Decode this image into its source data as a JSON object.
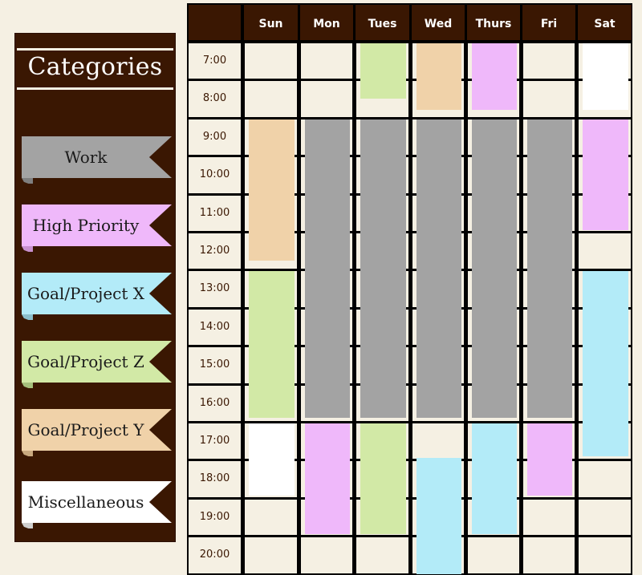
{
  "sidebar": {
    "title": "Categories",
    "categories": [
      {
        "key": "work",
        "label": "Work",
        "color": "#a3a3a3",
        "fold": "#7f7f7f"
      },
      {
        "key": "high",
        "label": "High Priority",
        "color": "#efb8fa",
        "fold": "#c890cf"
      },
      {
        "key": "goalx",
        "label": "Goal/Project X",
        "color": "#b3ebf8",
        "fold": "#8bbfcc"
      },
      {
        "key": "goalz",
        "label": "Goal/Project Z",
        "color": "#d2e9a6",
        "fold": "#a6c07c"
      },
      {
        "key": "goaly",
        "label": "Goal/Project Y",
        "color": "#f0d2a9",
        "fold": "#c9a97f"
      },
      {
        "key": "misc",
        "label": "Miscellaneous",
        "color": "#ffffff",
        "fold": "#cfcfcf"
      }
    ]
  },
  "calendar": {
    "days": [
      "Sun",
      "Mon",
      "Tues",
      "Wed",
      "Thurs",
      "Fri",
      "Sat"
    ],
    "hours": [
      "7:00",
      "8:00",
      "9:00",
      "10:00",
      "11:00",
      "12:00",
      "13:00",
      "14:00",
      "15:00",
      "16:00",
      "17:00",
      "18:00",
      "19:00",
      "20:00"
    ],
    "events": [
      {
        "day": 0,
        "start": 9,
        "end": 12.75,
        "category": "goaly"
      },
      {
        "day": 0,
        "start": 13,
        "end": 16.9,
        "category": "goalz"
      },
      {
        "day": 0,
        "start": 17,
        "end": 18.95,
        "category": "misc"
      },
      {
        "day": 1,
        "start": 9,
        "end": 16.9,
        "category": "work"
      },
      {
        "day": 1,
        "start": 17,
        "end": 19.95,
        "category": "high"
      },
      {
        "day": 2,
        "start": 7,
        "end": 8.5,
        "category": "goalz"
      },
      {
        "day": 2,
        "start": 9,
        "end": 16.9,
        "category": "work"
      },
      {
        "day": 2,
        "start": 17,
        "end": 19.95,
        "category": "goalz"
      },
      {
        "day": 3,
        "start": 7,
        "end": 8.8,
        "category": "goaly"
      },
      {
        "day": 3,
        "start": 9,
        "end": 16.9,
        "category": "work"
      },
      {
        "day": 3,
        "start": 17.9,
        "end": 21,
        "category": "goalx"
      },
      {
        "day": 4,
        "start": 7,
        "end": 8.8,
        "category": "high"
      },
      {
        "day": 4,
        "start": 9,
        "end": 16.9,
        "category": "work"
      },
      {
        "day": 4,
        "start": 17,
        "end": 19.95,
        "category": "goalx"
      },
      {
        "day": 5,
        "start": 9,
        "end": 16.9,
        "category": "work"
      },
      {
        "day": 5,
        "start": 17,
        "end": 18.95,
        "category": "high"
      },
      {
        "day": 6,
        "start": 7,
        "end": 8.8,
        "category": "misc"
      },
      {
        "day": 6,
        "start": 9,
        "end": 11.95,
        "category": "high"
      },
      {
        "day": 6,
        "start": 13,
        "end": 17.9,
        "category": "goalx"
      }
    ]
  }
}
